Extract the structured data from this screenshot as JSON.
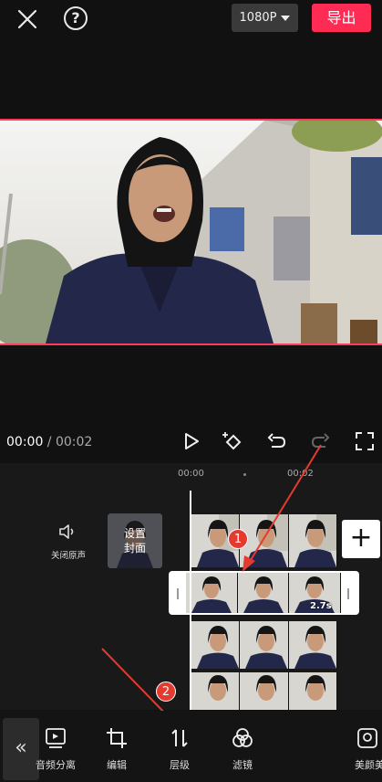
{
  "topbar": {
    "close_icon": "close-icon",
    "help_icon": "help-icon",
    "resolution_label": "1080P",
    "export_label": "导出",
    "export_color": "#fe2c55"
  },
  "player": {
    "current_time": "00:00",
    "separator": " / ",
    "total_time": "00:02"
  },
  "timeline": {
    "ruler_start": "00:00",
    "ruler_end": "00:02",
    "mute_label": "关闭原声",
    "cover_label_line1": "设置",
    "cover_label_line2": "封面",
    "selected_clip_duration": "2.7s",
    "add_label": "+",
    "selection_color": "#ff3b5c"
  },
  "annotations": {
    "badge_1": "1",
    "badge_2": "2"
  },
  "toolbar": {
    "collapse_label": "«",
    "items": [
      {
        "label": "音频分离",
        "icon": "audio-separate-icon"
      },
      {
        "label": "编辑",
        "icon": "crop-icon"
      },
      {
        "label": "层级",
        "icon": "layer-icon"
      },
      {
        "label": "滤镜",
        "icon": "filter-icon"
      },
      {
        "label": "美颜美体",
        "icon": "beauty-icon"
      }
    ]
  }
}
